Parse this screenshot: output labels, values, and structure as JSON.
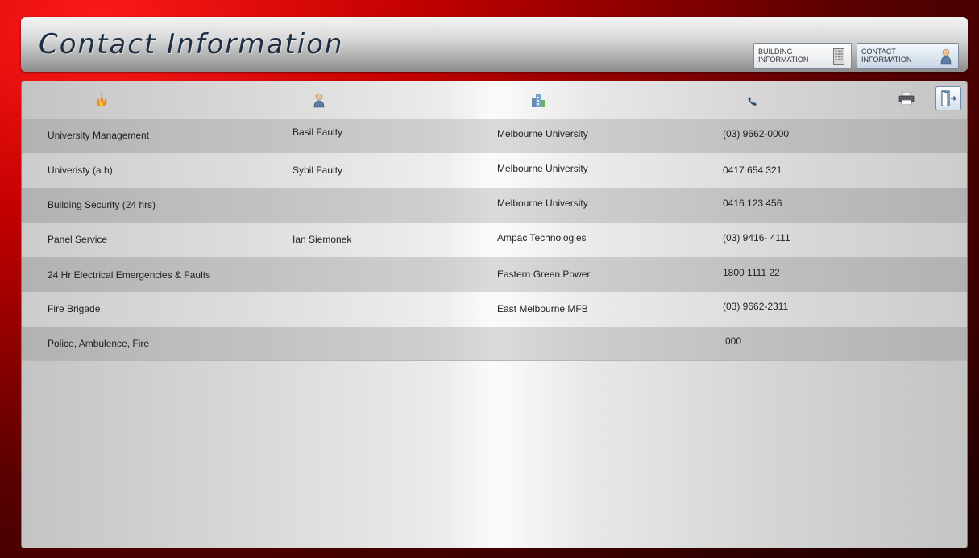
{
  "header": {
    "title": "Contact Information",
    "nav": [
      {
        "label": "BUILDING INFORMATION",
        "icon": "building-icon"
      },
      {
        "label": "CONTACT INFORMATION",
        "icon": "person-icon"
      }
    ]
  },
  "columns": [
    {
      "icon": "fire-icon"
    },
    {
      "icon": "person-icon"
    },
    {
      "icon": "buildings-icon"
    },
    {
      "icon": "phone-icon"
    }
  ],
  "toolbar": {
    "print_icon": "printer-icon",
    "exit_icon": "exit-door-icon"
  },
  "rows": [
    {
      "service": "University Management",
      "contact": "Basil Faulty",
      "organisation": "Melbourne University",
      "phone": "(03) 9662-0000"
    },
    {
      "service": "Univeristy (a.h).",
      "contact": "Sybil Faulty",
      "organisation": "Melbourne University",
      "phone": "0417 654 321"
    },
    {
      "service": "Building Security (24 hrs)",
      "contact": "",
      "organisation": "Melbourne University",
      "phone": "0416 123 456"
    },
    {
      "service": "Panel Service",
      "contact": "Ian Siemonek",
      "organisation": "Ampac Technologies",
      "phone": "(03) 9416- 4111"
    },
    {
      "service": "24 Hr Electrical Emergencies & Faults",
      "contact": "",
      "organisation": "Eastern Green Power",
      "phone": "1800 1111 22"
    },
    {
      "service": "Fire Brigade",
      "contact": "",
      "organisation": "East Melbourne MFB",
      "phone": "(03) 9662-2311"
    },
    {
      "service": "Police, Ambulence, Fire",
      "contact": "",
      "organisation": "",
      "phone": "000"
    }
  ]
}
